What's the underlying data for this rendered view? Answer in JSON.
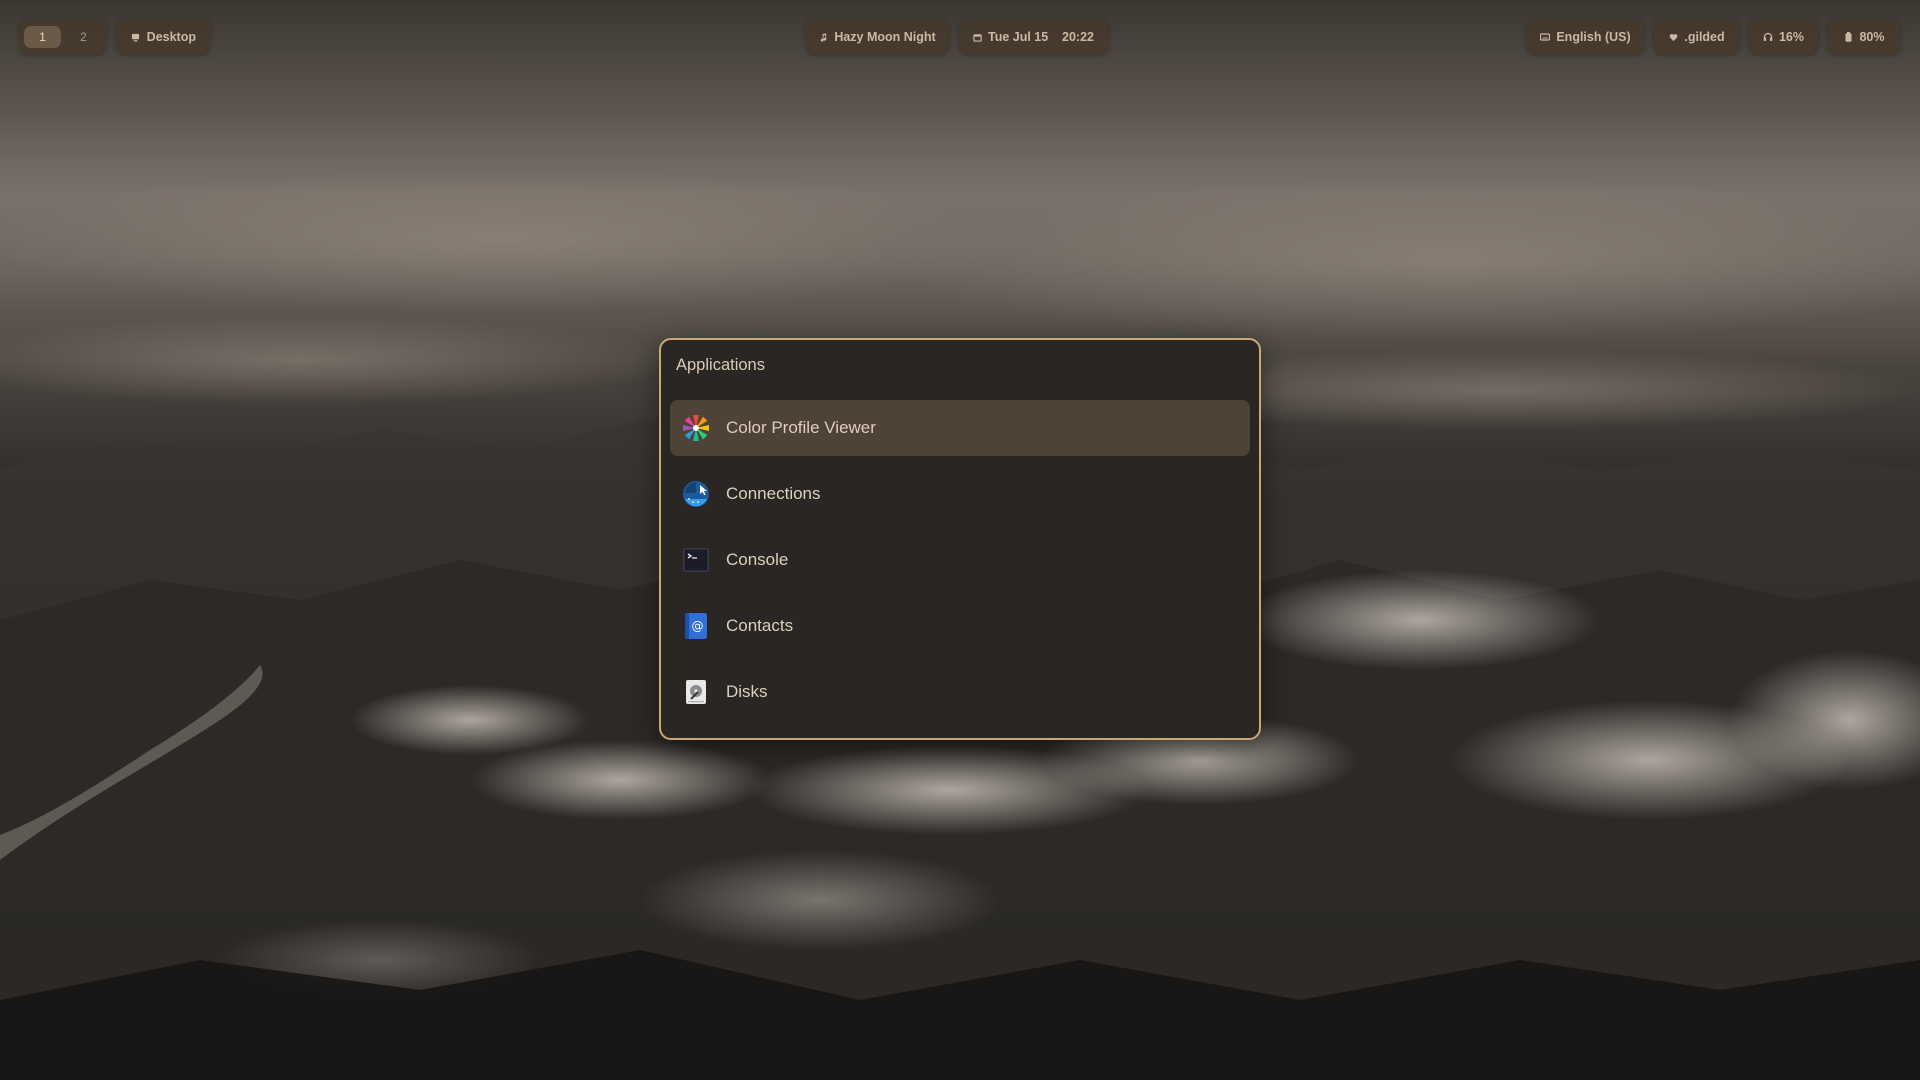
{
  "topbar": {
    "workspaces": [
      "1",
      "2"
    ],
    "active_workspace": "1",
    "desktop_label": "Desktop",
    "song_label": "Hazy Moon Night",
    "clock": {
      "date": "Tue Jul 15",
      "time": "20:22"
    },
    "language": "English (US)",
    "theme": ".gilded",
    "volume": "16%",
    "battery": "80%"
  },
  "launcher": {
    "title": "Applications",
    "selected_index": 0,
    "items": [
      {
        "label": "Color Profile Viewer",
        "icon": "color-wheel-icon"
      },
      {
        "label": "Connections",
        "icon": "remote-desktop-icon"
      },
      {
        "label": "Console",
        "icon": "terminal-icon"
      },
      {
        "label": "Contacts",
        "icon": "address-book-icon"
      },
      {
        "label": "Disks",
        "icon": "disk-utility-icon"
      }
    ]
  },
  "colors": {
    "accent_border": "#c9a876",
    "selected_row": "#4f4236",
    "pill_bg": "#46382c",
    "text": "#dccfbd"
  }
}
